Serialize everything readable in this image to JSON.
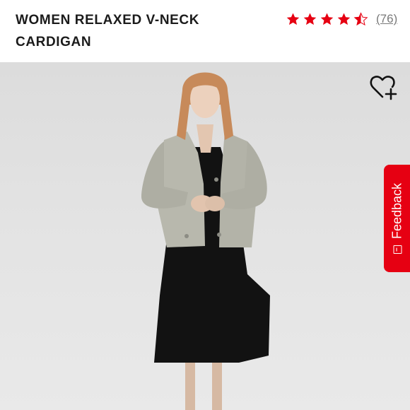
{
  "product": {
    "title": "WOMEN RELAXED V-NECK CARDIGAN"
  },
  "rating": {
    "stars": 4.5,
    "max_stars": 5,
    "review_count": "(76)",
    "star_color": "#e60012"
  },
  "wishlist": {
    "icon": "heart-plus-icon"
  },
  "feedback": {
    "label": "Feedback",
    "icon_glyph": "[-]",
    "color": "#e60012"
  },
  "hero": {
    "background": "#e1e1e1",
    "cardigan_color": "#b8b8ad",
    "dress_color": "#111111"
  }
}
